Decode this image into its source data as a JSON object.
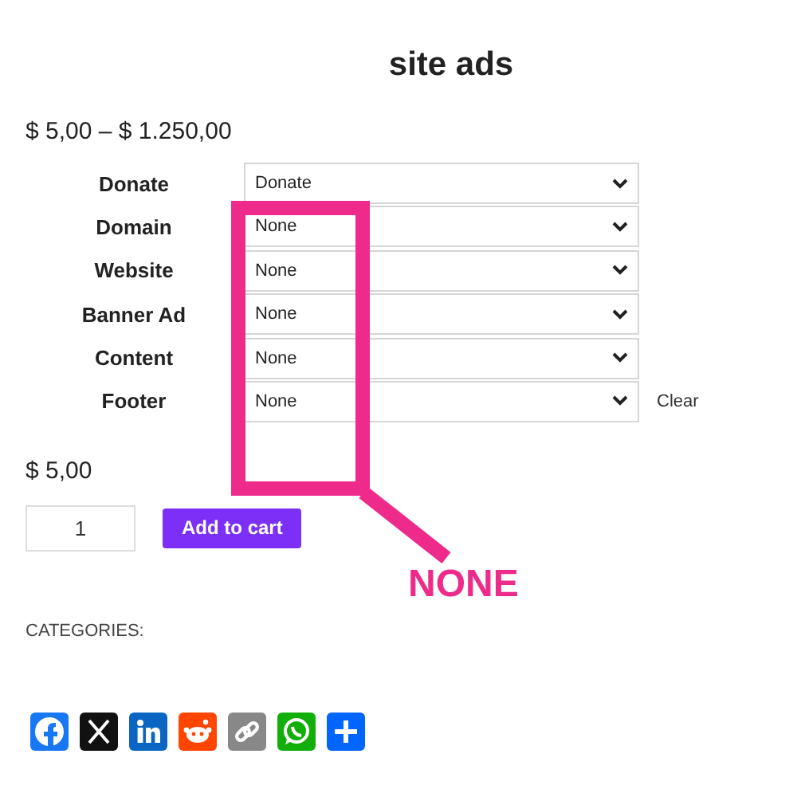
{
  "title": "site ads",
  "price_range": "$ 5,00 – $ 1.250,00",
  "variations": [
    {
      "label": "Donate",
      "value": "Donate"
    },
    {
      "label": "Domain",
      "value": "None"
    },
    {
      "label": "Website",
      "value": "None"
    },
    {
      "label": "Banner Ad",
      "value": "None"
    },
    {
      "label": "Content",
      "value": "None"
    },
    {
      "label": "Footer",
      "value": "None"
    }
  ],
  "clear_link": "Clear",
  "price": "$ 5,00",
  "quantity": "1",
  "add_to_cart": "Add to cart",
  "categories_label": "CATEGORIES:",
  "annotation": {
    "text": "NONE"
  }
}
